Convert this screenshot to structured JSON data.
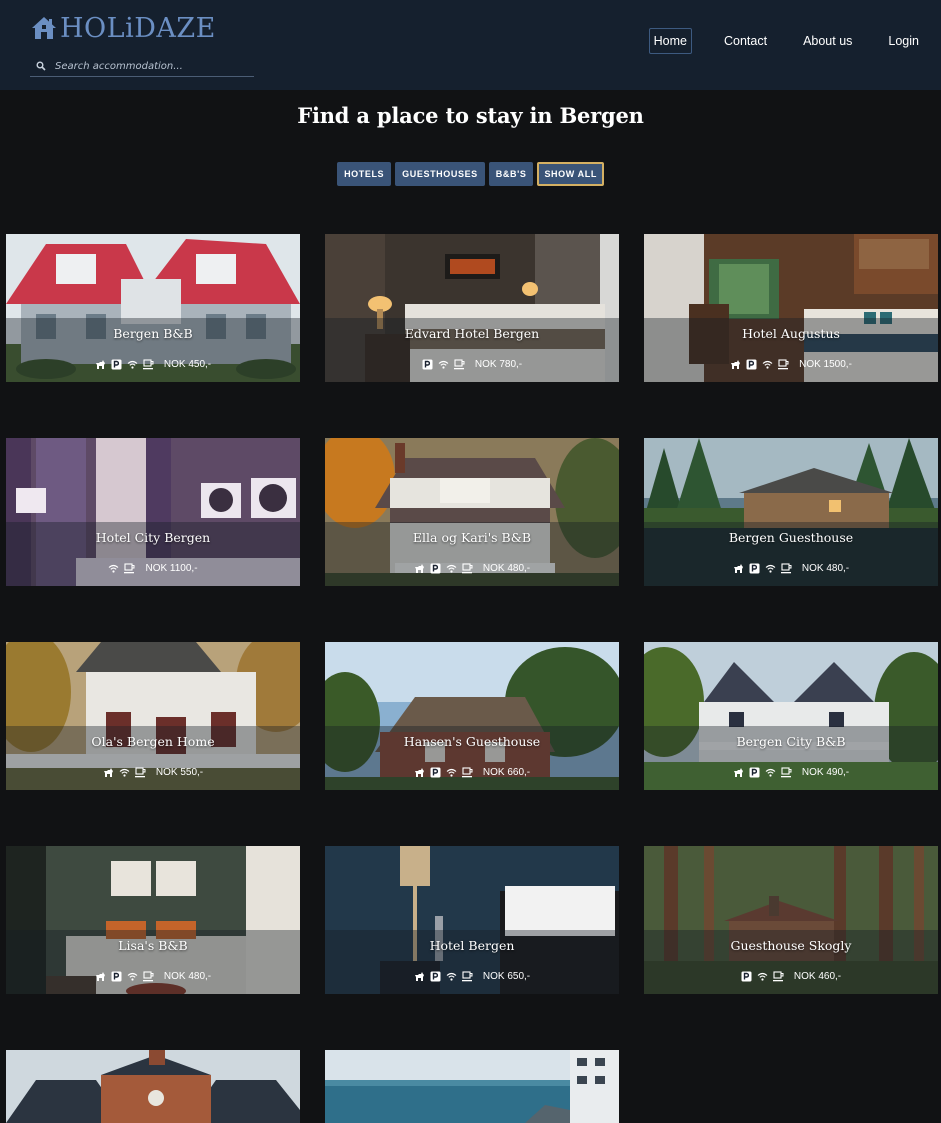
{
  "header": {
    "logo_text": "HOLiDAZE",
    "search_placeholder": "Search accommodation...",
    "nav": [
      "Home",
      "Contact",
      "About us",
      "Login"
    ]
  },
  "page_title": "Find a place to stay in Bergen",
  "filters": [
    "HOTELS",
    "GUESTHOUSES",
    "B&B'S",
    "SHOW ALL"
  ],
  "colors": {
    "header_bg": "#15202e",
    "page_bg": "#111214",
    "accent": "#3a5478",
    "active_border": "#d4b063",
    "logo": "#6b8fc3"
  },
  "accommodations": [
    {
      "name": "Bergen B&B",
      "price": "NOK 450,-",
      "amenities": [
        "pets-icon",
        "parking-icon",
        "wifi-icon",
        "breakfast-icon"
      ]
    },
    {
      "name": "Edvard Hotel Bergen",
      "price": "NOK 780,-",
      "amenities": [
        "parking-icon",
        "wifi-icon",
        "breakfast-icon"
      ]
    },
    {
      "name": "Hotel Augustus",
      "price": "NOK 1500,-",
      "amenities": [
        "pets-icon",
        "parking-icon",
        "wifi-icon",
        "breakfast-icon"
      ]
    },
    {
      "name": "Hotel City Bergen",
      "price": "NOK 1100,-",
      "amenities": [
        "wifi-icon",
        "breakfast-icon"
      ]
    },
    {
      "name": "Ella og Kari's B&B",
      "price": "NOK 480,-",
      "amenities": [
        "pets-icon",
        "parking-icon",
        "wifi-icon",
        "breakfast-icon"
      ]
    },
    {
      "name": "Bergen Guesthouse",
      "price": "NOK 480,-",
      "amenities": [
        "pets-icon",
        "parking-icon",
        "wifi-icon",
        "breakfast-icon"
      ]
    },
    {
      "name": "Ola's Bergen Home",
      "price": "NOK 550,-",
      "amenities": [
        "pets-icon",
        "wifi-icon",
        "breakfast-icon"
      ]
    },
    {
      "name": "Hansen's Guesthouse",
      "price": "NOK 660,-",
      "amenities": [
        "pets-icon",
        "parking-icon",
        "wifi-icon",
        "breakfast-icon"
      ]
    },
    {
      "name": "Bergen City B&B",
      "price": "NOK 490,-",
      "amenities": [
        "pets-icon",
        "parking-icon",
        "wifi-icon",
        "breakfast-icon"
      ]
    },
    {
      "name": "Lisa's B&B",
      "price": "NOK 480,-",
      "amenities": [
        "pets-icon",
        "parking-icon",
        "wifi-icon",
        "breakfast-icon"
      ]
    },
    {
      "name": "Hotel Bergen",
      "price": "NOK 650,-",
      "amenities": [
        "pets-icon",
        "parking-icon",
        "wifi-icon",
        "breakfast-icon"
      ]
    },
    {
      "name": "Guesthouse Skogly",
      "price": "NOK 460,-",
      "amenities": [
        "parking-icon",
        "wifi-icon",
        "breakfast-icon"
      ]
    }
  ]
}
